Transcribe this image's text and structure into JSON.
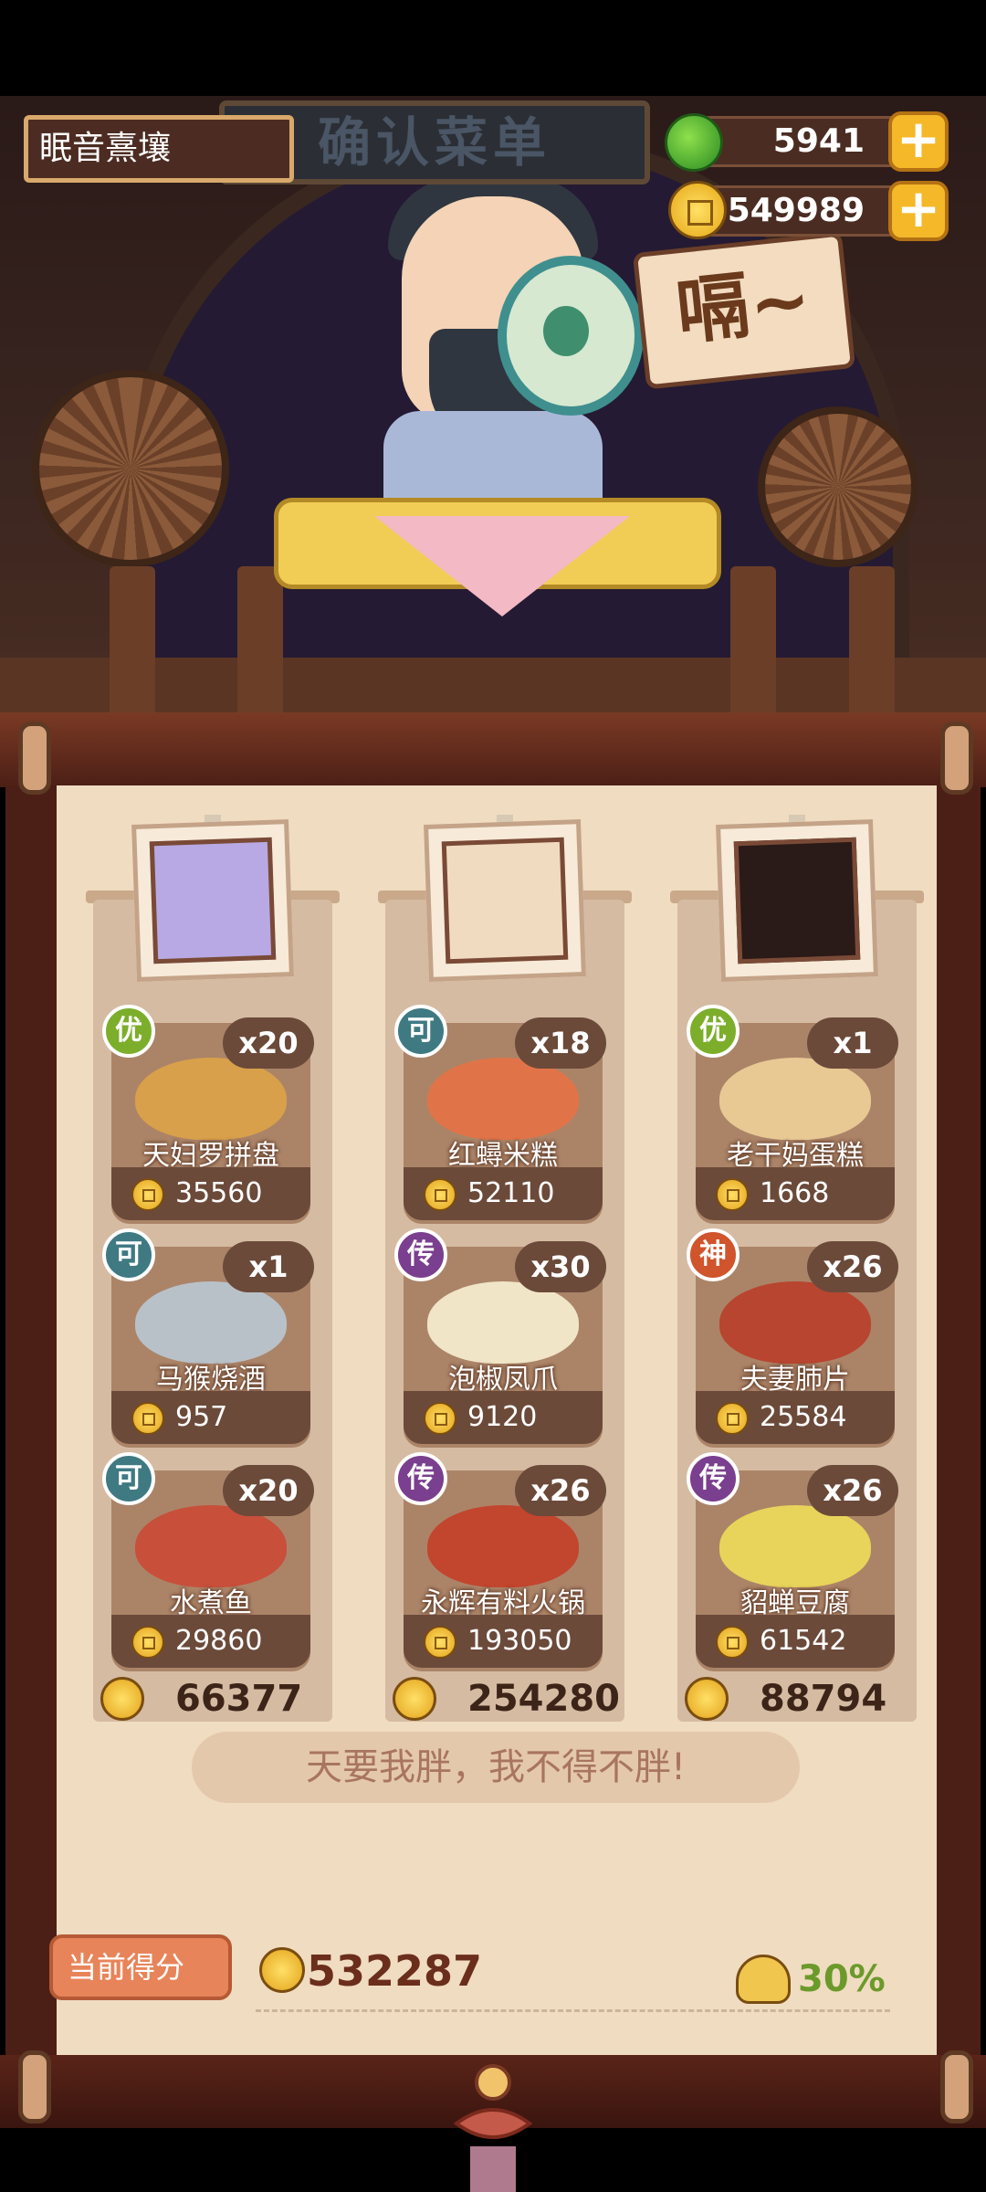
{
  "header": {
    "title": "确认菜单",
    "player_name": "眠音熹壤",
    "jade_value": "5941",
    "coin_value": "549989",
    "plus_symbol": "+"
  },
  "scene": {
    "speech_text": "嗝~"
  },
  "customers": [
    {
      "total": "66377",
      "dishes": [
        {
          "grade": "优",
          "grade_color": "#7cae2c",
          "count": "x20",
          "name": "天妇罗拼盘",
          "price": "35560",
          "color": "#d8a04a"
        },
        {
          "grade": "可",
          "grade_color": "#3f7a82",
          "count": "x1",
          "name": "马猴烧酒",
          "price": "957",
          "color": "#b9c1c8"
        },
        {
          "grade": "可",
          "grade_color": "#3f7a82",
          "count": "x20",
          "name": "水煮鱼",
          "price": "29860",
          "color": "#c84f3a"
        }
      ]
    },
    {
      "total": "254280",
      "dishes": [
        {
          "grade": "可",
          "grade_color": "#3f7a82",
          "count": "x18",
          "name": "红蟳米糕",
          "price": "52110",
          "color": "#e07448"
        },
        {
          "grade": "传",
          "grade_color": "#7a3f8e",
          "count": "x30",
          "name": "泡椒凤爪",
          "price": "9120",
          "color": "#f1e5c8"
        },
        {
          "grade": "传",
          "grade_color": "#7a3f8e",
          "count": "x26",
          "name": "永辉有料火锅",
          "price": "193050",
          "color": "#c2452e"
        }
      ]
    },
    {
      "total": "88794",
      "dishes": [
        {
          "grade": "优",
          "grade_color": "#7cae2c",
          "count": "x1",
          "name": "老干妈蛋糕",
          "price": "1668",
          "color": "#e8c994"
        },
        {
          "grade": "神",
          "grade_color": "#d0542c",
          "count": "x26",
          "name": "夫妻肺片",
          "price": "25584",
          "color": "#b8452f"
        },
        {
          "grade": "传",
          "grade_color": "#7a3f8e",
          "count": "x26",
          "name": "貂蝉豆腐",
          "price": "61542",
          "color": "#e8d45a"
        }
      ]
    }
  ],
  "slogan": "天要我胖，我不得不胖!",
  "score": {
    "label": "当前得分",
    "value": "532287",
    "bonus": "30%"
  }
}
